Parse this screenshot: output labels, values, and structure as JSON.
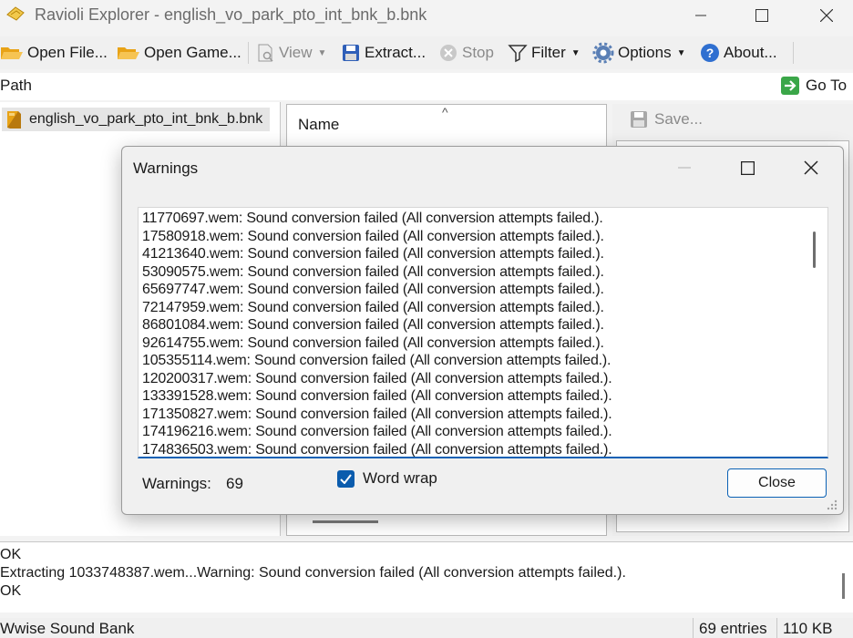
{
  "window": {
    "title": "Ravioli Explorer - english_vo_park_pto_int_bnk_b.bnk",
    "icon": "ravioli-app-icon"
  },
  "toolbar": {
    "open_file": "Open File...",
    "open_game": "Open Game...",
    "view": "View",
    "extract": "Extract...",
    "stop": "Stop",
    "filter": "Filter",
    "options": "Options",
    "about": "About..."
  },
  "pathbar": {
    "label": "Path",
    "goto": "Go To"
  },
  "tree": {
    "item": "english_vo_park_pto_int_bnk_b.bnk"
  },
  "list": {
    "column_name": "Name",
    "sort_glyph": "^"
  },
  "preview": {
    "save": "Save..."
  },
  "log": {
    "lines": [
      "OK",
      "Extracting 1033748387.wem...Warning: Sound conversion failed (All conversion attempts failed.).",
      "OK"
    ]
  },
  "status": {
    "type": "Wwise Sound Bank",
    "entries": "69 entries",
    "size": "110 KB"
  },
  "dialog": {
    "title": "Warnings",
    "warnings": [
      "11770697.wem: Sound conversion failed (All conversion attempts failed.).",
      "17580918.wem: Sound conversion failed (All conversion attempts failed.).",
      "41213640.wem: Sound conversion failed (All conversion attempts failed.).",
      "53090575.wem: Sound conversion failed (All conversion attempts failed.).",
      "65697747.wem: Sound conversion failed (All conversion attempts failed.).",
      "72147959.wem: Sound conversion failed (All conversion attempts failed.).",
      "86801084.wem: Sound conversion failed (All conversion attempts failed.).",
      "92614755.wem: Sound conversion failed (All conversion attempts failed.).",
      "105355114.wem: Sound conversion failed (All conversion attempts failed.).",
      "120200317.wem: Sound conversion failed (All conversion attempts failed.).",
      "133391528.wem: Sound conversion failed (All conversion attempts failed.).",
      "171350827.wem: Sound conversion failed (All conversion attempts failed.).",
      "174196216.wem: Sound conversion failed (All conversion attempts failed.).",
      "174836503.wem: Sound conversion failed (All conversion attempts failed.)."
    ],
    "count_label": "Warnings:",
    "count": "69",
    "word_wrap_label": "Word wrap",
    "word_wrap_checked": true,
    "close_label": "Close"
  },
  "colors": {
    "accent": "#0b61b5",
    "window_bg": "#f3f3f3",
    "folder": "#e8a317"
  }
}
